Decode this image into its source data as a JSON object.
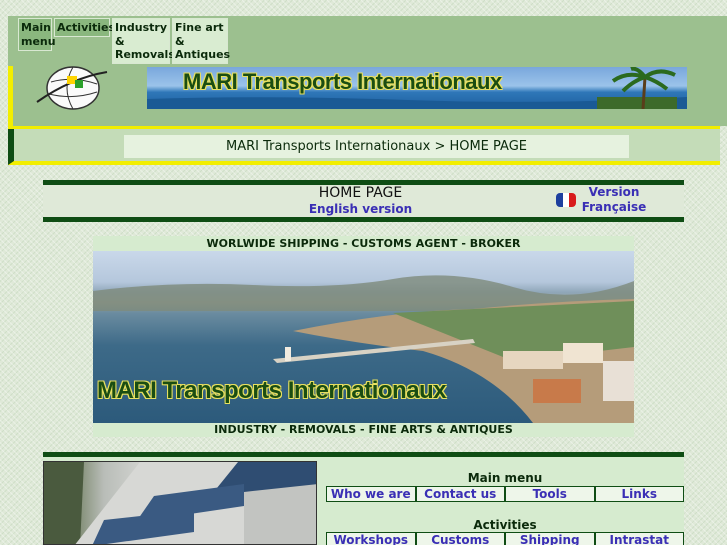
{
  "topnav": {
    "main_menu": "Main menu",
    "activities": "Activities",
    "industry_removals": "Industry & Removals",
    "fine_art": "Fine art & Antiques"
  },
  "banner": {
    "title": "MARI Transports Internationaux"
  },
  "breadcrumb": {
    "text": "MARI Transports Internationaux > HOME PAGE"
  },
  "page": {
    "title": "HOME PAGE",
    "english_link": "English version",
    "french_link_line1": "Version",
    "french_link_line2": "Française",
    "flag_colors": [
      "#1d3f9e",
      "#ffffff",
      "#d81b1b"
    ]
  },
  "photo": {
    "top_caption": "WORLWIDE SHIPPING - CUSTOMS AGENT - BROKER",
    "overlay_title": "MARI Transports Internationaux",
    "bottom_caption": "INDUSTRY - REMOVALS - FINE ARTS & ANTIQUES"
  },
  "main_menu": {
    "title": "Main menu",
    "items": [
      "Who we are",
      "Contact us",
      "Tools",
      "Links"
    ]
  },
  "activities": {
    "title": "Activities",
    "items": [
      "Workshops",
      "Customs",
      "Shipping",
      "Intrastat"
    ]
  },
  "colors": {
    "dark_green": "#0f4d14",
    "nav_green": "#9cc08f",
    "accent_yellow": "#f2ee00",
    "link_blue": "#3a2fb5"
  }
}
